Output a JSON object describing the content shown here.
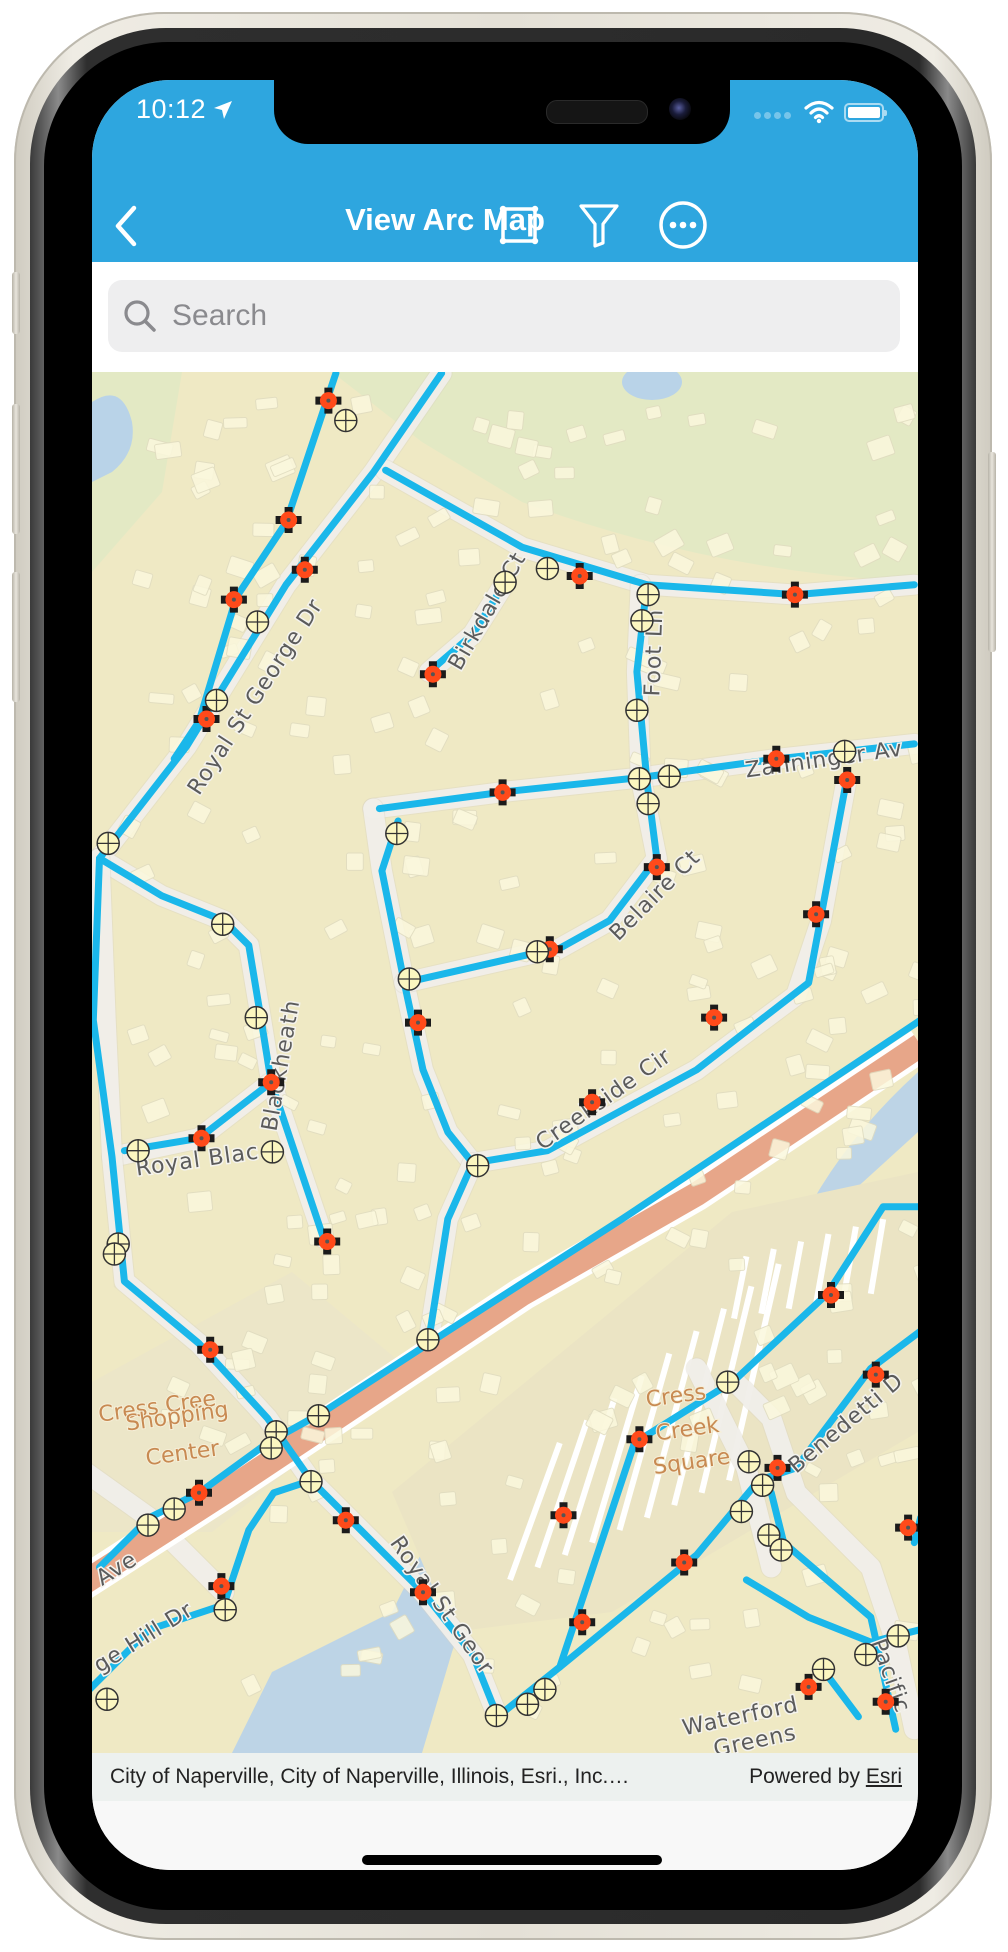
{
  "device": {
    "model_look": "iPhone with starlight frame"
  },
  "status_bar": {
    "time": "10:12",
    "location_icon": "location-arrow-icon",
    "wifi_icon": "wifi-icon",
    "battery_icon": "battery-icon",
    "signal_icon": "cellular-signal-icon"
  },
  "navbar": {
    "back_icon": "chevron-left-icon",
    "title": "View Arc Map",
    "actions": [
      {
        "name": "select-extent",
        "icon": "square-selection-icon"
      },
      {
        "name": "filter",
        "icon": "funnel-icon"
      },
      {
        "name": "more",
        "icon": "ellipsis-circle-icon"
      }
    ],
    "color": "#2ea6df"
  },
  "search": {
    "placeholder": "Search",
    "value": "",
    "icon": "magnifier-icon"
  },
  "map": {
    "street_labels": {
      "royal_st_george_dr_north": "Royal St George Dr",
      "birkdale_ct": "Birkdale Ct",
      "foot_ln": "Foot Ln",
      "zahninger_av": "Zahninger Av",
      "belaire_ct": "Belaire Ct",
      "blackheath": "Blackheath",
      "royal_black": "Royal Blac",
      "creekside_cir": "Creekside Cir",
      "ave": "Ave",
      "hill_dr": "ge Hill Dr",
      "royal_st_george_south": "Royal St Geor",
      "benedetti": "Benedetti D",
      "pacific": "Pacific"
    },
    "poi_labels": {
      "shopping_center": [
        "Cress Cree",
        "Shopping",
        "Center"
      ],
      "creek_square": [
        "Cress",
        "Creek",
        "Square"
      ],
      "waterford_greens": [
        "Waterford",
        "Greens"
      ]
    },
    "legend_colors": {
      "water_main": "#1ab7ea",
      "valve_fill": "#ff4a1a",
      "hydrant_fill": "#fbf6c0",
      "arterial_road": "#e7a689",
      "water_body": "#b9d3e8",
      "park": "#e2e9c3",
      "base": "#efe9c4"
    }
  },
  "attribution": {
    "sources": "City of Naperville, City of Naperville, Illinois, Esri., Inc.…",
    "powered_by_prefix": "Powered by ",
    "powered_by_link": "Esri"
  }
}
